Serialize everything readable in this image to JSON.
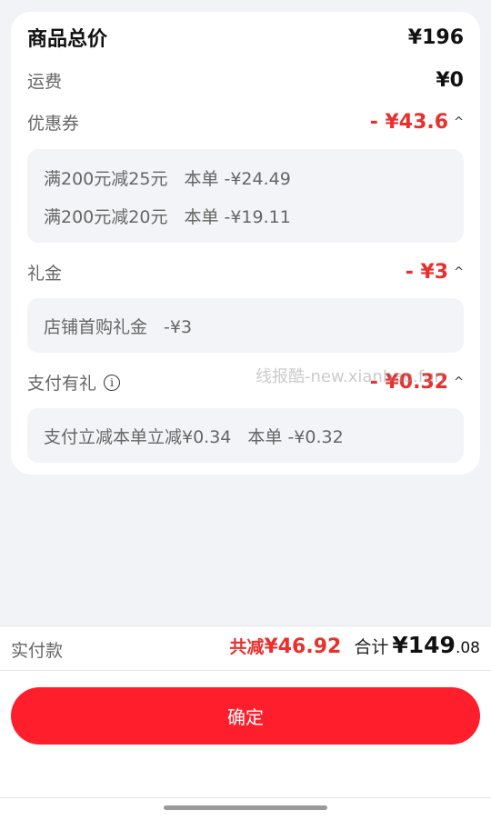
{
  "total": {
    "label": "商品总价",
    "value": "¥196"
  },
  "shipping": {
    "label": "运费",
    "value": "¥0"
  },
  "coupon": {
    "label": "优惠券",
    "value": "- ¥43.6",
    "items": [
      {
        "name": "满200元减25元",
        "note": "本单 -¥24.49"
      },
      {
        "name": "满200元减20元",
        "note": "本单 -¥19.11"
      }
    ]
  },
  "gift": {
    "label": "礼金",
    "value": "- ¥3",
    "items": [
      {
        "name": "店铺首购礼金",
        "note": "-¥3"
      }
    ]
  },
  "payment_gift": {
    "label": "支付有礼",
    "value": "- ¥0.32",
    "items": [
      {
        "name": "支付立减本单立减¥0.34",
        "note": "本单 -¥0.32"
      }
    ]
  },
  "watermark": "线报酷-new.xianbao.fun",
  "summary": {
    "paid_label": "实付款",
    "discount_label": "共减",
    "discount_value": "¥46.92",
    "total_label": "合计",
    "total_int": "¥149",
    "total_dec": ".08"
  },
  "confirm_label": "确定",
  "colors": {
    "accent": "#fe1e2c",
    "discount": "#e9302d",
    "background": "#f2f3f7"
  }
}
